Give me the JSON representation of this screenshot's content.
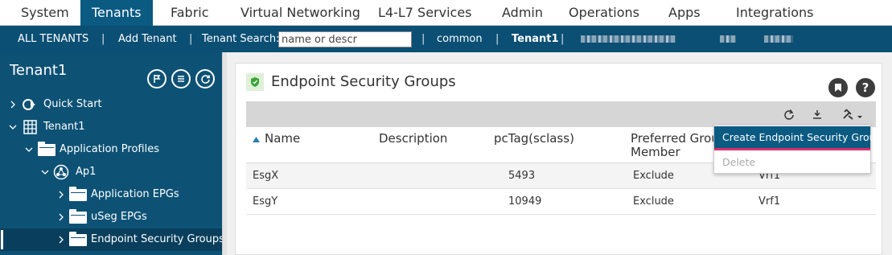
{
  "topnav": {
    "tabs": [
      {
        "label": "System"
      },
      {
        "label": "Tenants"
      },
      {
        "label": "Fabric"
      },
      {
        "label": "Virtual Networking"
      },
      {
        "label": "L4-L7 Services"
      },
      {
        "label": "Admin"
      },
      {
        "label": "Operations"
      },
      {
        "label": "Apps"
      },
      {
        "label": "Integrations"
      }
    ],
    "active_tab": "Tenants"
  },
  "subnav": {
    "all_tenants": "ALL TENANTS",
    "add_tenant": "Add Tenant",
    "search_label": "Tenant Search:",
    "search_placeholder": "name or descr",
    "common": "common",
    "tenant1": "Tenant1",
    "separator": "|"
  },
  "sidebar": {
    "title": "Tenant1",
    "tree": [
      {
        "label": "Quick Start"
      },
      {
        "label": "Tenant1"
      },
      {
        "label": "Application Profiles"
      },
      {
        "label": "Ap1"
      },
      {
        "label": "Application EPGs"
      },
      {
        "label": "uSeg EPGs"
      },
      {
        "label": "Endpoint Security Groups"
      }
    ]
  },
  "panel": {
    "title": "Endpoint Security Groups",
    "help_label": "?",
    "columns": {
      "name": "Name",
      "description": "Description",
      "pctag": "pcTag(sclass)",
      "preferred_line1": "Preferred Group",
      "preferred_line2": "Member"
    },
    "rows": [
      {
        "name": "EsgX",
        "description": "",
        "pctag": "5493",
        "preferred": "Exclude",
        "vrf": "Vrf1"
      },
      {
        "name": "EsgY",
        "description": "",
        "pctag": "10949",
        "preferred": "Exclude",
        "vrf": "Vrf1"
      }
    ]
  },
  "dropdown": {
    "create": "Create Endpoint Security Group",
    "delete": "Delete"
  },
  "colors": {
    "nav_active": "#0a5a82",
    "subnav_bg": "#0b4f74",
    "sidebar_bg": "#0d5275",
    "accent_underline": "#d6306c",
    "shield_green": "#3aa53a"
  },
  "icons": [
    "chevron-right-icon",
    "chevron-down-icon",
    "quick-start-icon",
    "building-icon",
    "folder-icon",
    "app-profile-icon",
    "shield-icon",
    "bookmark-icon",
    "help-icon",
    "refresh-icon",
    "download-icon",
    "tools-icon",
    "sort-asc-icon"
  ]
}
